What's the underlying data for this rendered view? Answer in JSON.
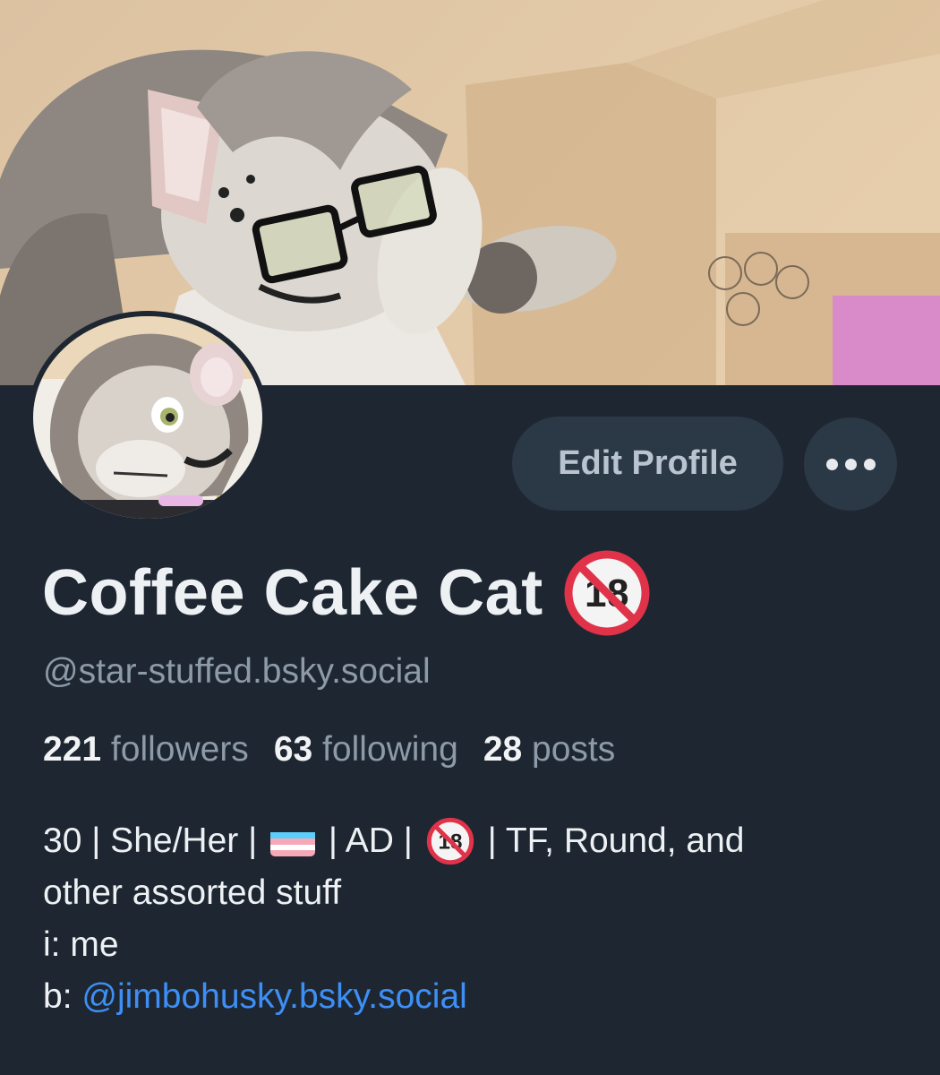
{
  "profile": {
    "display_name": "Coffee Cake Cat",
    "handle": "@star-stuffed.bsky.social",
    "edit_button_label": "Edit Profile",
    "more_button_icon": "ellipsis-icon",
    "badge_icon": "no-one-under-eighteen-icon"
  },
  "stats": {
    "followers_count": "221",
    "followers_label": "followers",
    "following_count": "63",
    "following_label": "following",
    "posts_count": "28",
    "posts_label": "posts"
  },
  "bio": {
    "line1_a": "30 | She/Her |",
    "line1_flag_icon": "transgender-flag-icon",
    "line1_b": "| AD |",
    "line1_badge_icon": "no-one-under-eighteen-icon",
    "line1_c": "| TF, Round, and",
    "line2": "other assorted stuff",
    "line3": "i: me",
    "line4_prefix": "b:",
    "line4_link": "@jimbohusky.bsky.social"
  },
  "colors": {
    "background": "#1e2731",
    "button_bg": "#2b3845",
    "muted_text": "#8d9aa8",
    "link": "#3d8ff5",
    "badge_red": "#e0334a"
  }
}
